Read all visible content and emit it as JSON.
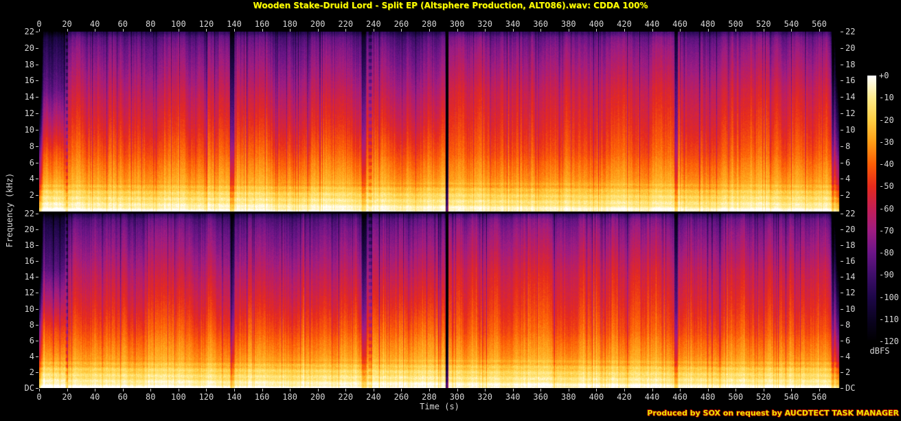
{
  "title": "Wooden Stake-Druid Lord - Split EP (Altsphere Production, ALT086).wav: CDDA 100%",
  "footer": {
    "text": "Produced by SOX on request by AUCDTECT TASK MANAGER"
  },
  "colors": {
    "background": "#000000",
    "title_text": "#ffff00",
    "footer_text": "#e9e900",
    "footer_outline": "#990000",
    "tick_text": "#d6d6d6",
    "tick_mark": "#cfcfcf"
  },
  "chart_data": {
    "type": "heatmap",
    "subtype": "audio-spectrogram",
    "title": "Wooden Stake-Druid Lord - Split EP (Altsphere Production, ALT086).wav: CDDA 100%",
    "xlabel": "Time (s)",
    "ylabel": "Frequency (kHz)",
    "channels": [
      "left",
      "right"
    ],
    "x_range_s": [
      0,
      574.8
    ],
    "x_ticks_s": [
      0,
      20,
      40,
      60,
      80,
      100,
      120,
      140,
      160,
      180,
      200,
      220,
      240,
      260,
      280,
      300,
      320,
      340,
      360,
      380,
      400,
      420,
      440,
      460,
      480,
      500,
      520,
      540,
      560
    ],
    "y_range_khz": [
      0,
      22
    ],
    "y_tick_labels": [
      22,
      20,
      18,
      16,
      14,
      12,
      10,
      8,
      6,
      4,
      2
    ],
    "y_bottom_label": "DC",
    "grid": false,
    "legend_position": "right-colorbar",
    "colorbar": {
      "unit": "dBFS",
      "tick_labels": [
        "+0",
        "-10",
        "-20",
        "-30",
        "-40",
        "-50",
        "-60",
        "-70",
        "-80",
        "-90",
        "-100",
        "-110",
        "-120"
      ],
      "tick_values_db": [
        0,
        -10,
        -20,
        -30,
        -40,
        -50,
        -60,
        -70,
        -80,
        -90,
        -100,
        -110,
        -120
      ],
      "palette_hex": [
        "#ffffff",
        "#ffeb8c",
        "#ffcf44",
        "#ff9e17",
        "#fc5e06",
        "#e62a1c",
        "#c51f54",
        "#9e1c82",
        "#6c1587",
        "#3f0e6b",
        "#1e0749",
        "#0b0322",
        "#000000"
      ]
    },
    "content": {
      "summary": "Two-channel (left above, right below) SoX spectrogram of a full EP. Loud dense music from DC to ~21 kHz for nearly the whole duration: near 0 dBFS below 1 kHz (bright white-yellow floor line), yellow-orange 1-6 kHz, red 6-12 kHz, magenta-purple above 16 kHz, dark navy at 22 kHz. Quiet purple breaks near 19 s, 138 s, 233-240 s, a near-silent track gap at ~292 s, a quiet break at ~457 s, and a fade-out after ~567 s. Strong vertical beat striping throughout; highs slightly brighter after 293 s.",
      "freq_profile_db": [
        [
          0,
          -2
        ],
        [
          0.25,
          -5
        ],
        [
          0.8,
          -11
        ],
        [
          1.5,
          -15
        ],
        [
          2.2,
          -19
        ],
        [
          3,
          -26
        ],
        [
          4,
          -31
        ],
        [
          5,
          -34
        ],
        [
          6,
          -37
        ],
        [
          7,
          -41
        ],
        [
          8,
          -44
        ],
        [
          10,
          -50
        ],
        [
          12,
          -55
        ],
        [
          14,
          -60
        ],
        [
          16,
          -66
        ],
        [
          18,
          -72
        ],
        [
          20,
          -78
        ],
        [
          21.3,
          -84
        ],
        [
          21.8,
          -93
        ],
        [
          22,
          -97
        ]
      ],
      "sections": [
        {
          "t0_s": 0,
          "t1_s": 18.5,
          "low_boost_db": 7,
          "high_adj_db": -18
        },
        {
          "t0_s": 18.5,
          "t1_s": 136.5,
          "low_boost_db": 2.5,
          "high_adj_db": 0
        },
        {
          "t0_s": 140.5,
          "t1_s": 231.0,
          "low_boost_db": 2.5,
          "high_adj_db": -1
        },
        {
          "t0_s": 239.0,
          "t1_s": 291.3,
          "low_boost_db": 2,
          "high_adj_db": -2
        },
        {
          "t0_s": 293.7,
          "t1_s": 455.4,
          "low_boost_db": 1,
          "high_adj_db": 5
        },
        {
          "t0_s": 458.6,
          "t1_s": 567.0,
          "low_boost_db": 1.5,
          "high_adj_db": 4
        },
        {
          "t0_s": 567.0,
          "t1_s": 575.0,
          "low_boost_db": 0,
          "high_adj_db": 0
        }
      ],
      "quiet_bands": [
        {
          "t_s": 19.6,
          "width_s": 2.0,
          "depth_db": 24,
          "dashed": true
        },
        {
          "t_s": 138.5,
          "width_s": 4.0,
          "depth_db": 30,
          "dashed": false
        },
        {
          "t_s": 149.0,
          "width_s": 1.2,
          "depth_db": 14,
          "dashed": false
        },
        {
          "t_s": 233.0,
          "width_s": 4.5,
          "depth_db": 26,
          "dashed": false
        },
        {
          "t_s": 237.5,
          "width_s": 3.0,
          "depth_db": 20,
          "dashed": true
        },
        {
          "t_s": 244.0,
          "width_s": 1.2,
          "depth_db": 14,
          "dashed": false
        },
        {
          "t_s": 292.5,
          "width_s": 2.4,
          "depth_db": 105,
          "dashed": false
        },
        {
          "t_s": 457.0,
          "width_s": 3.2,
          "depth_db": 32,
          "dashed": false
        },
        {
          "t_s": 569.5,
          "width_s": 2.0,
          "depth_db": 25,
          "dashed": false
        }
      ],
      "fade_in_s": 3,
      "fade_out_start_s": 567.5
    }
  }
}
